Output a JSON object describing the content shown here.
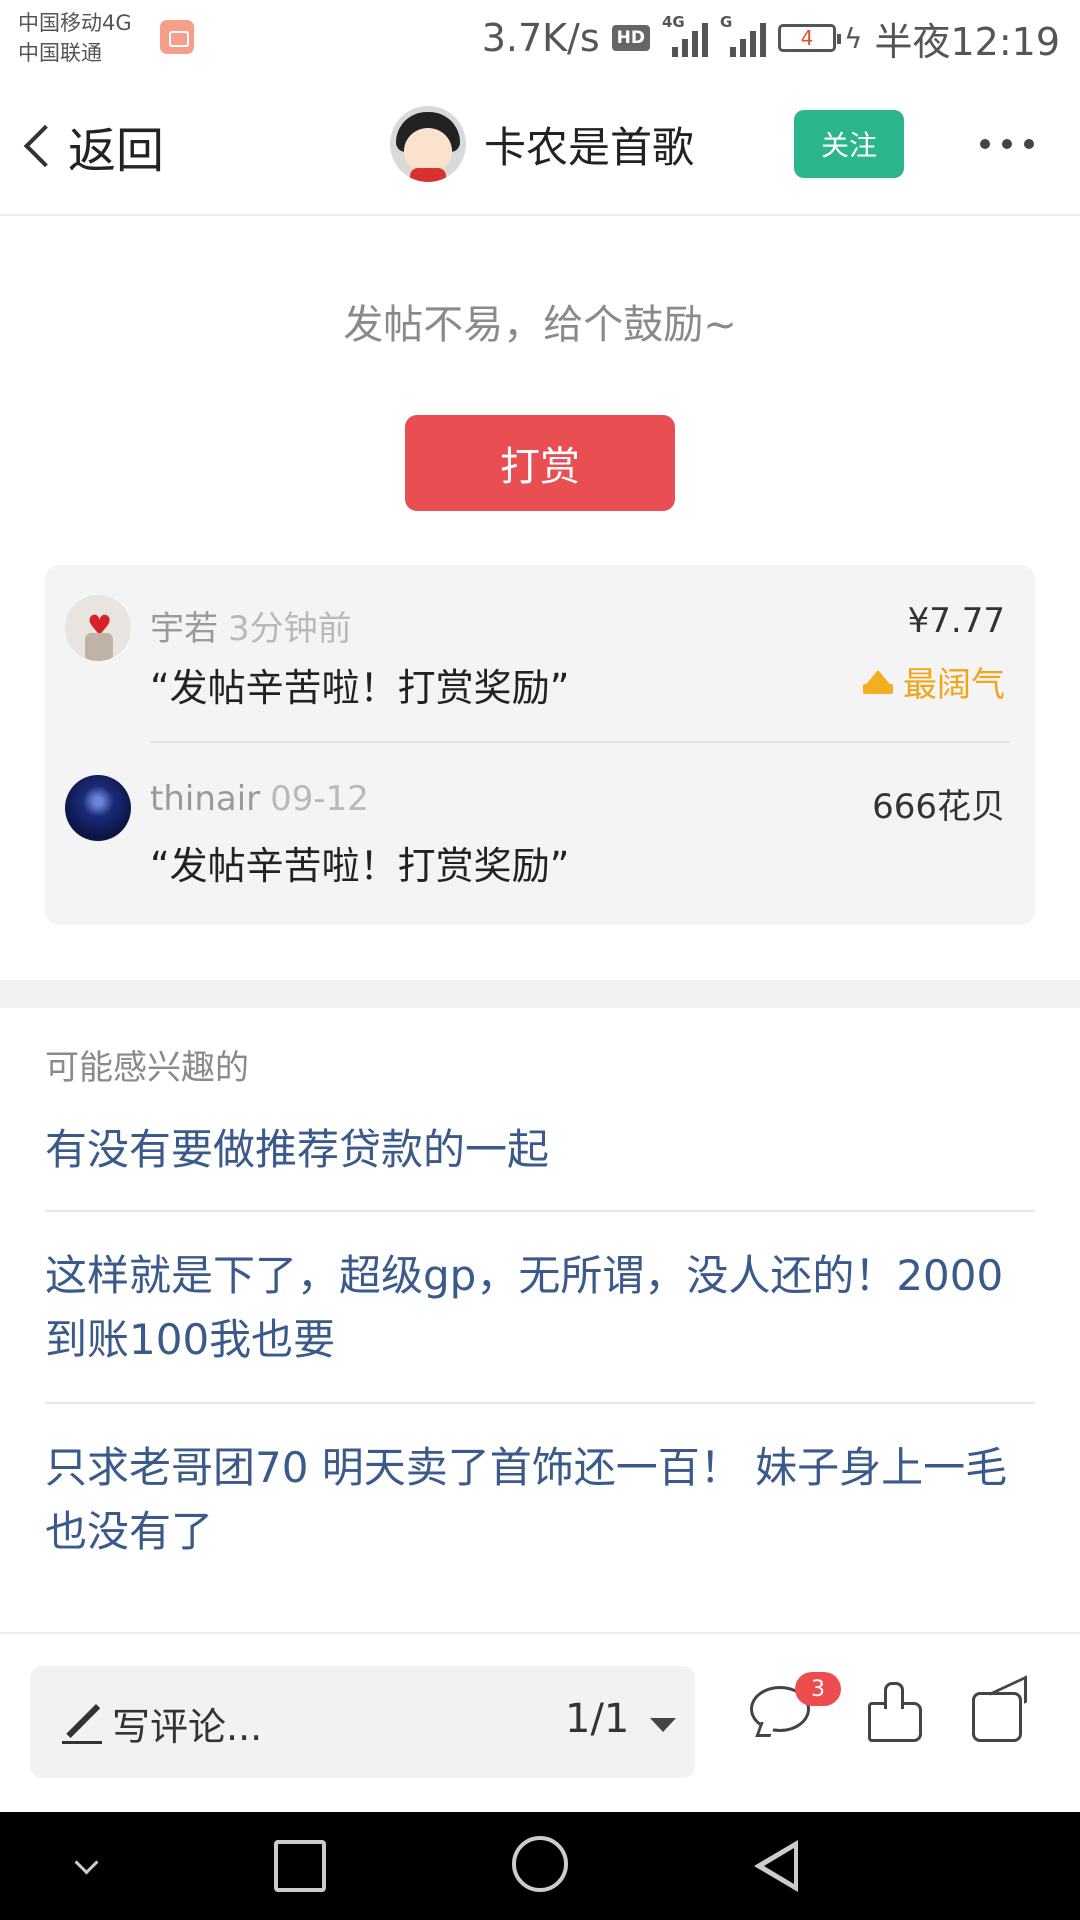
{
  "status_bar": {
    "carrier1": "中国移动4G",
    "carrier2": "中国联通",
    "net_speed": "3.7K/s",
    "hd": "HD",
    "signal1_tag": "4G",
    "signal2_tag": "G",
    "battery_level": "4",
    "time": "半夜12:19"
  },
  "nav": {
    "back_label": "返回",
    "author_name": "卡农是首歌",
    "follow_label": "关注"
  },
  "reward": {
    "prompt": "发帖不易，给个鼓励~",
    "button_label": "打赏",
    "tips": [
      {
        "user": "宇若",
        "time": "3分钟前",
        "message": "“发帖辛苦啦！打赏奖励”",
        "amount": "¥7.77",
        "badge": "最阔气"
      },
      {
        "user": "thinair",
        "time": "09-12",
        "message": "“发帖辛苦啦！打赏奖励”",
        "amount": "666花贝"
      }
    ]
  },
  "recommend": {
    "title": "可能感兴趣的",
    "items": [
      {
        "text": "有没有要做推荐贷款的一起"
      },
      {
        "text": "这样就是下了，超级gp，无所谓，没人还的！2000到账100我也要"
      },
      {
        "text": "只求老哥团70 明天卖了首饰还一百！ 妹子身上一毛也没有了"
      }
    ]
  },
  "bottom_bar": {
    "comment_placeholder": "写评论...",
    "page_indicator": "1/1",
    "comment_count": "3"
  },
  "colors": {
    "follow_green": "#2bb58b",
    "reward_red": "#e94e52",
    "badge_gold": "#f0a51b",
    "link_blue": "#3a5a8c"
  }
}
